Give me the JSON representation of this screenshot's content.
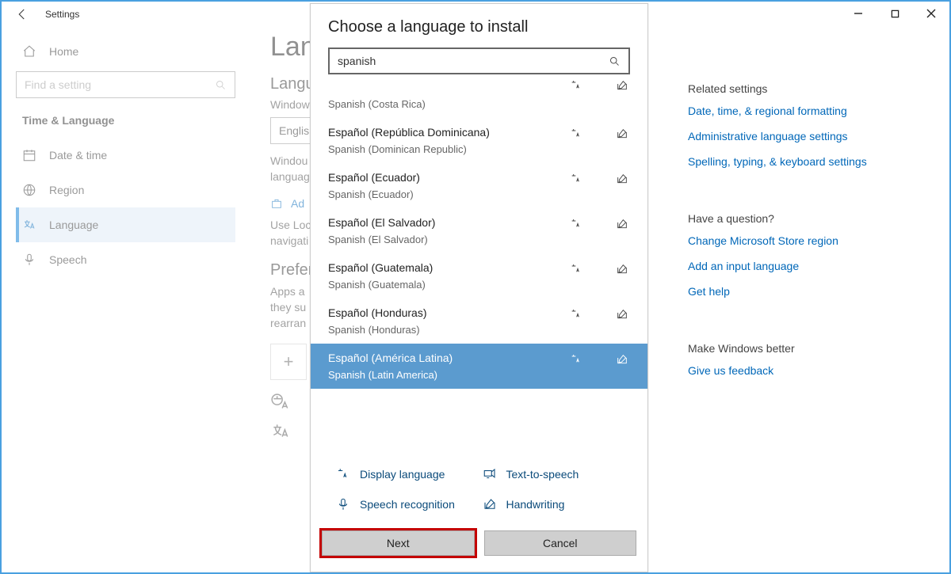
{
  "titlebar": {
    "title": "Settings"
  },
  "sidebar": {
    "home": "Home",
    "search_placeholder": "Find a setting",
    "group": "Time & Language",
    "items": [
      {
        "label": "Date & time"
      },
      {
        "label": "Region"
      },
      {
        "label": "Language"
      },
      {
        "label": "Speech"
      }
    ]
  },
  "main": {
    "h1": "Lan",
    "h2a": "Langu",
    "sub_display": "Window",
    "select_value": "Englis",
    "para_display": "Windou\nlanguag",
    "addlink": "Ad",
    "para_local": "Use Loc\nnavigati",
    "h2b": "Preferr",
    "para_pref": "Apps a\nthey su\nrearran"
  },
  "right": {
    "relhdr": "Related settings",
    "rel": [
      "Date, time, & regional formatting",
      "Administrative language settings",
      "Spelling, typing, & keyboard settings"
    ],
    "qhdr": "Have a question?",
    "q": [
      "Change Microsoft Store region",
      "Add an input language",
      "Get help"
    ],
    "fbhdr": "Make Windows better",
    "fb": [
      "Give us feedback"
    ]
  },
  "dialog": {
    "title": "Choose a language to install",
    "search_value": "spanish",
    "top_clip": {
      "eng": "Spanish (Costa Rica)"
    },
    "langs": [
      {
        "native": "Español (República Dominicana)",
        "eng": "Spanish (Dominican Republic)"
      },
      {
        "native": "Español (Ecuador)",
        "eng": "Spanish (Ecuador)"
      },
      {
        "native": "Español (El Salvador)",
        "eng": "Spanish (El Salvador)"
      },
      {
        "native": "Español (Guatemala)",
        "eng": "Spanish (Guatemala)"
      },
      {
        "native": "Español (Honduras)",
        "eng": "Spanish (Honduras)"
      },
      {
        "native": "Español (América Latina)",
        "eng": "Spanish (Latin America)"
      }
    ],
    "features": {
      "display": "Display language",
      "tts": "Text-to-speech",
      "speech": "Speech recognition",
      "hand": "Handwriting"
    },
    "buttons": {
      "next": "Next",
      "cancel": "Cancel"
    }
  }
}
